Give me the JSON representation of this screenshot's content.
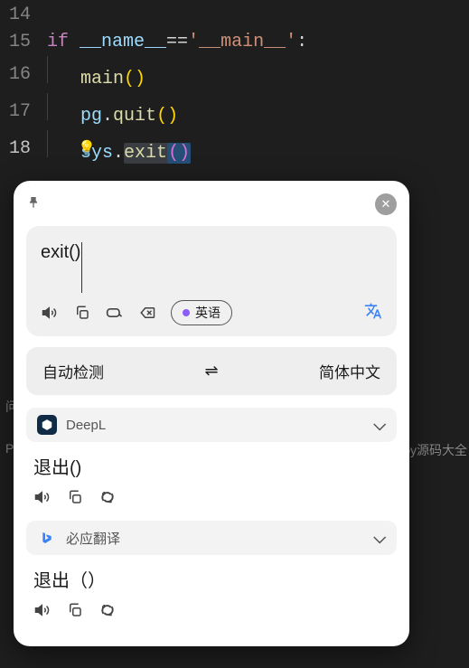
{
  "editor": {
    "lines": {
      "l14": "14",
      "l15": "15",
      "l16": "16",
      "l17": "17",
      "l18": "18"
    },
    "tokens": {
      "if": "if",
      "name": "__name__",
      "eq": "==",
      "main_str": "'__main__'",
      "colon": ":",
      "main_fn": "main",
      "parens": "()",
      "pg": "pg",
      "dot": ".",
      "quit": "quit",
      "sys": "sys",
      "exit": "exit"
    }
  },
  "bg": {
    "left1": "问",
    "left2": "P",
    "right": "py源码大全"
  },
  "popup": {
    "input_text": "exit()",
    "source_lang": "英语",
    "auto_detect": "自动检测",
    "target_lang": "简体中文",
    "providers": {
      "deepl": {
        "name": "DeepL",
        "result": "退出()"
      },
      "bing": {
        "name": "必应翻译",
        "result": "退出（）"
      }
    }
  }
}
